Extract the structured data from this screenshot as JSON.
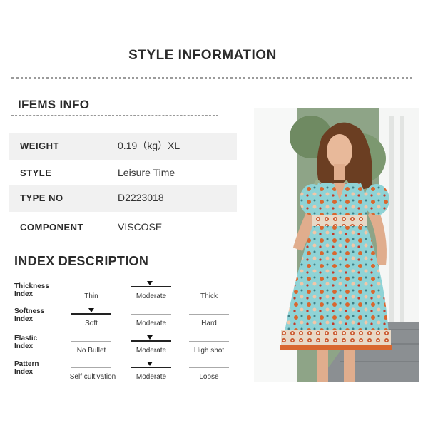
{
  "header": {
    "title": "STYLE INFORMATION"
  },
  "items_info": {
    "heading": "IFEMS INFO",
    "rows": [
      {
        "label": "WEIGHT",
        "value": "0.19（kg）XL"
      },
      {
        "label": "STYLE",
        "value": "Leisure Time"
      },
      {
        "label": "TYPE NO",
        "value": "D2223018"
      },
      {
        "label": "COMPONENT",
        "value": "VISCOSE"
      }
    ]
  },
  "index_description": {
    "heading": "INDEX DESCRIPTION",
    "indexes": [
      {
        "label_line1": "Thickness",
        "label_line2": "Index",
        "options": [
          "Thin",
          "Moderate",
          "Thick"
        ],
        "selected": "Moderate"
      },
      {
        "label_line1": "Softness",
        "label_line2": "Index",
        "options": [
          "Soft",
          "Moderate",
          "Hard"
        ],
        "selected": "Soft"
      },
      {
        "label_line1": "Elastic",
        "label_line2": "Index",
        "options": [
          "No Bullet",
          "Moderate",
          "High shot"
        ],
        "selected": "Moderate"
      },
      {
        "label_line1": "Pattern",
        "label_line2": "Index",
        "options": [
          "Self cultivation",
          "Moderate",
          "Loose"
        ],
        "selected": "Moderate"
      }
    ]
  },
  "product_photo": {
    "icon": "dress-photo"
  },
  "colors": {
    "dress": "#8fd3d6",
    "accent": "#d9672f",
    "marker": "#111111"
  }
}
